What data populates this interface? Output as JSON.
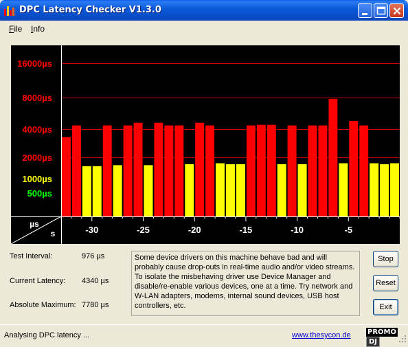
{
  "window": {
    "title": "DPC Latency Checker V1.3.0"
  },
  "menu": {
    "file": "File",
    "file_key": "F",
    "file_rest": "ile",
    "info": "Info",
    "info_key": "I",
    "info_rest": "nfo"
  },
  "colors": {
    "red": "#ff0000",
    "yellow": "#ffff00",
    "green": "#00ff00",
    "black": "#000000"
  },
  "chart_data": {
    "type": "bar",
    "ylabel_unit": "µs",
    "xlabel_unit": "s",
    "y_ticks": [
      {
        "label": "16000µs",
        "value": 16000,
        "color": "red",
        "gridline": true
      },
      {
        "label": "8000µs",
        "value": 8000,
        "color": "red",
        "gridline": true
      },
      {
        "label": "4000µs",
        "value": 4000,
        "color": "red",
        "gridline": true
      },
      {
        "label": "2000µs",
        "value": 2000,
        "color": "red",
        "gridline": true
      },
      {
        "label": "1000µs",
        "value": 1000,
        "color": "yellow",
        "gridline": false
      },
      {
        "label": "500µs",
        "value": 500,
        "color": "green",
        "gridline": false
      }
    ],
    "x_ticks": [
      "-30",
      "-25",
      "-20",
      "-15",
      "-10",
      "-5"
    ],
    "x_tick_values": [
      -30,
      -25,
      -20,
      -15,
      -10,
      -5
    ],
    "x_range": [
      -33,
      0
    ],
    "bar_values": [
      3300,
      4340,
      1500,
      1500,
      4340,
      1550,
      4340,
      4600,
      1550,
      4600,
      4340,
      4340,
      1600,
      4600,
      4340,
      1650,
      1600,
      1600,
      4340,
      4400,
      4400,
      1600,
      4340,
      1600,
      4340,
      4340,
      7780,
      1650,
      4800,
      4340,
      1650,
      1600,
      1650
    ]
  },
  "panel": {
    "test_interval_label": "Test Interval:",
    "test_interval_value": "976 µs",
    "current_latency_label": "Current Latency:",
    "current_latency_value": "4340 µs",
    "absolute_max_label": "Absolute Maximum:",
    "absolute_max_value": "7780 µs",
    "info_text": "Some device drivers on this machine behave bad and will probably cause drop-outs in real-time audio and/or video streams. To isolate the misbehaving driver use Device Manager and disable/re-enable various devices, one at a time. Try network and W-LAN adapters, modems, internal sound devices, USB host controllers, etc."
  },
  "buttons": {
    "stop": "Stop",
    "reset": "Reset",
    "exit": "Exit"
  },
  "status": {
    "text": "Analysing DPC latency ...",
    "link": "www.thesycon.de",
    "logo_a": "PROMO",
    "logo_b": "DJ"
  }
}
